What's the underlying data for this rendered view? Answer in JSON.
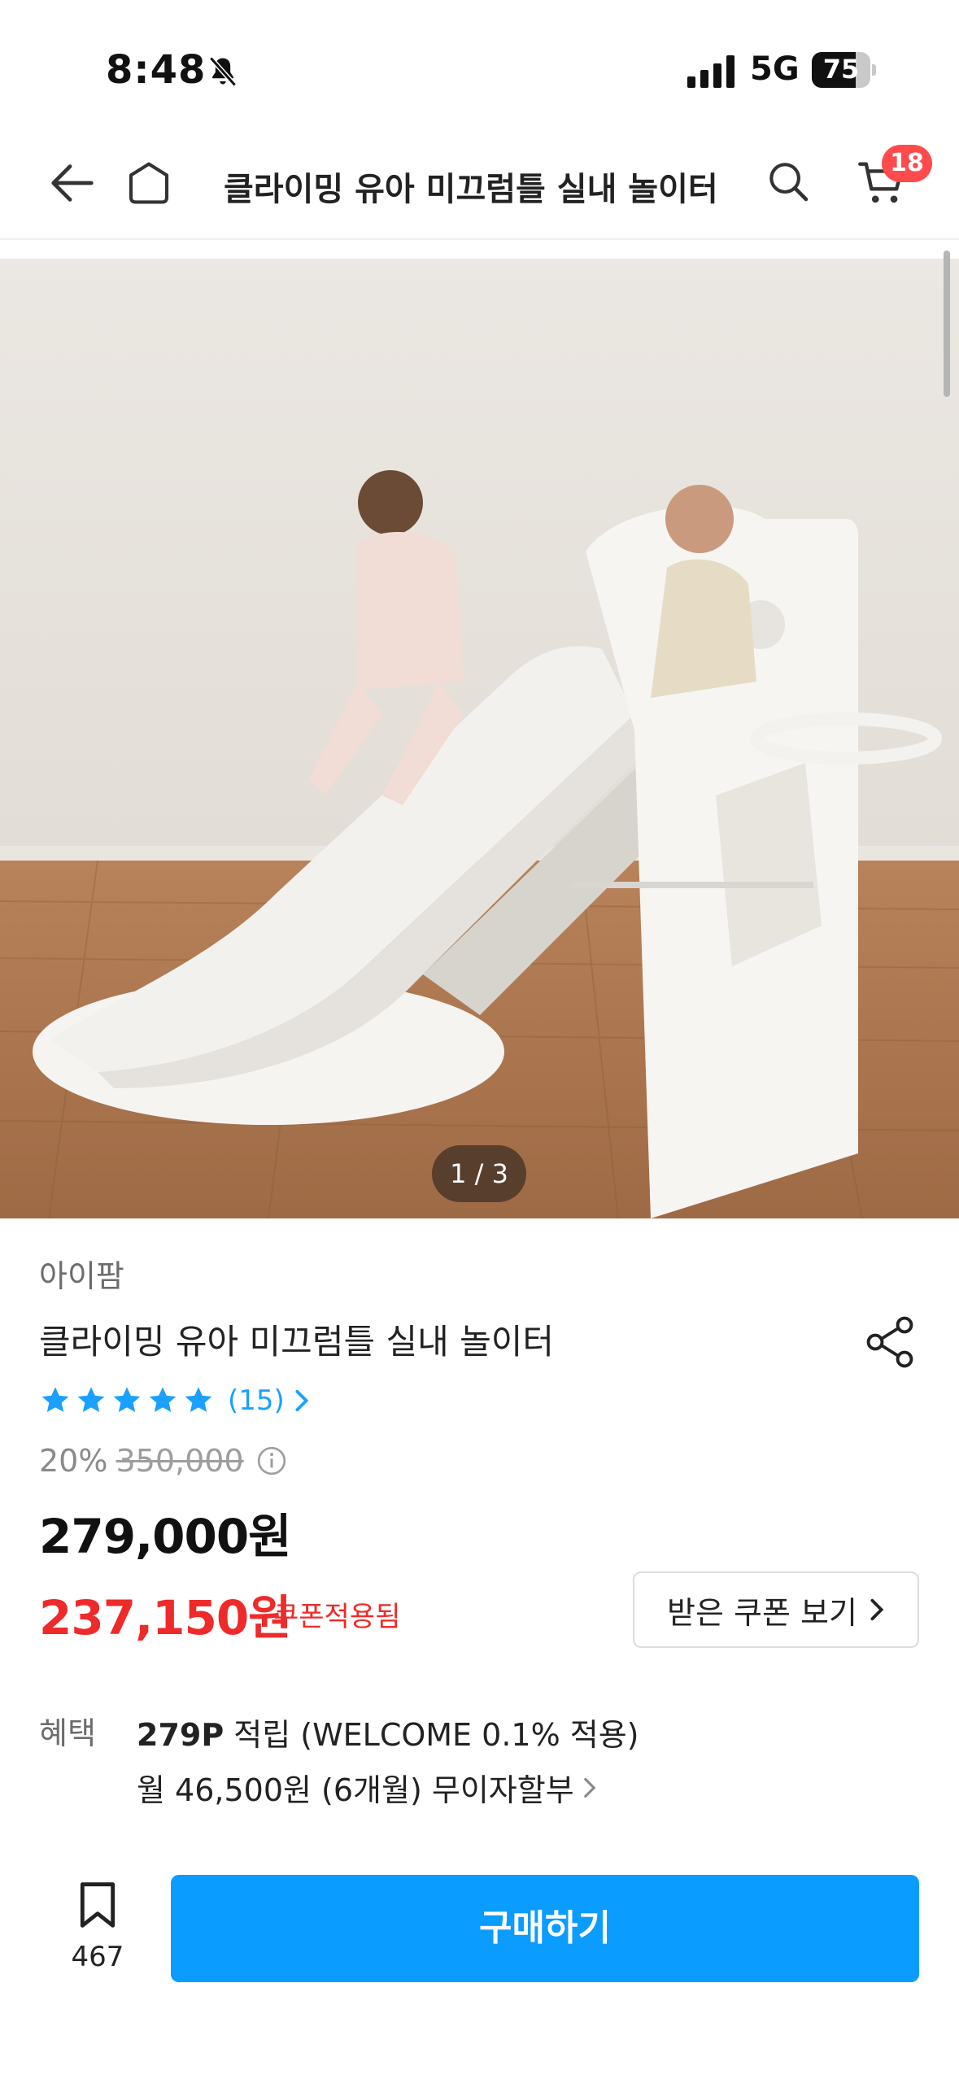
{
  "status_bar": {
    "time": "8:48",
    "network": "5G",
    "battery": "75",
    "battery_level": 0.75
  },
  "nav": {
    "title": "클라이밍 유아 미끄럼틀 실내 놀이터",
    "cart_count": "18"
  },
  "gallery": {
    "counter": "1 / 3",
    "image_description_icon": "product-photo"
  },
  "product": {
    "brand": "아이팜",
    "name": "클라이밍 유아 미끄럼틀 실내 놀이터",
    "rating_stars": 5,
    "review_count": "(15)",
    "discount_rate": "20%",
    "original_price": "350,000",
    "sale_price": "279,000원",
    "coupon_price": "237,150원",
    "coupon_applied_label": "쿠폰적용됨",
    "coupon_button_label": "받은 쿠폰 보기"
  },
  "benefit": {
    "label": "혜택",
    "points_bold": "279P",
    "points_rest": " 적립 (WELCOME 0.1% 적용)",
    "installment": "월 46,500원 (6개월) 무이자할부"
  },
  "bottom": {
    "wish_count": "467",
    "buy_label": "구매하기"
  },
  "colors": {
    "accent_blue": "#0a9cff",
    "price_red": "#ee2a2a",
    "badge_red": "#ff4b4b",
    "star_blue": "#1aa0ff"
  }
}
